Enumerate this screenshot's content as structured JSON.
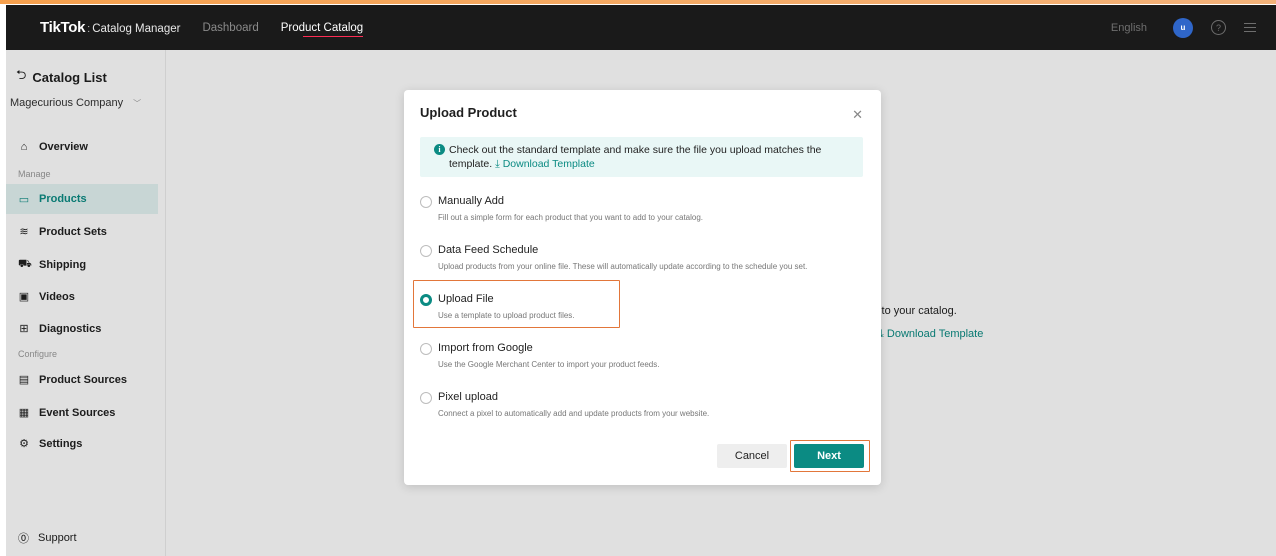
{
  "topbar": {
    "brand_logo": "TikTok",
    "brand_separator": ":",
    "brand_subtitle": "Catalog Manager",
    "nav": [
      {
        "label": "Dashboard"
      },
      {
        "label": "Product Catalog"
      }
    ],
    "language": "English",
    "avatar_initial": "u",
    "help_glyph": "?"
  },
  "sidebar": {
    "back_label": "Catalog List",
    "company": "Magecurious Company",
    "items": [
      {
        "label": "Overview",
        "icon": "home-icon"
      },
      {
        "label": "Products",
        "icon": "products-icon"
      },
      {
        "label": "Product Sets",
        "icon": "product-sets-icon"
      },
      {
        "label": "Shipping",
        "icon": "shipping-icon"
      },
      {
        "label": "Videos",
        "icon": "video-icon"
      },
      {
        "label": "Diagnostics",
        "icon": "diagnostics-icon"
      },
      {
        "label": "Product Sources",
        "icon": "product-sources-icon"
      },
      {
        "label": "Event Sources",
        "icon": "event-sources-icon"
      },
      {
        "label": "Settings",
        "icon": "settings-icon"
      }
    ],
    "sections": {
      "manage": "Manage",
      "configure": "Configure"
    },
    "support": "Support"
  },
  "background": {
    "text_fragment": "s to your catalog.",
    "link_fragment": "Download Template"
  },
  "modal": {
    "title": "Upload Product",
    "notice_text": "Check out the standard template and make sure the file you upload matches the template.",
    "notice_link": "Download Template",
    "options": [
      {
        "title": "Manually Add",
        "description": "Fill out a simple form for each product that you want to add to your catalog.",
        "selected": false
      },
      {
        "title": "Data Feed Schedule",
        "description": "Upload products from your online file. These will automatically update according to the schedule you set.",
        "selected": false
      },
      {
        "title": "Upload File",
        "description": "Use a template to upload product files.",
        "selected": true
      },
      {
        "title": "Import from Google",
        "description": "Use the Google Merchant Center to import your product feeds.",
        "selected": false
      },
      {
        "title": "Pixel upload",
        "description": "Connect a pixel to automatically add and update products from your website.",
        "selected": false
      }
    ],
    "cancel_label": "Cancel",
    "next_label": "Next"
  },
  "colors": {
    "accent": "#0b8b83",
    "topbar": "#1a1a1a",
    "highlight": "#e2763a"
  }
}
